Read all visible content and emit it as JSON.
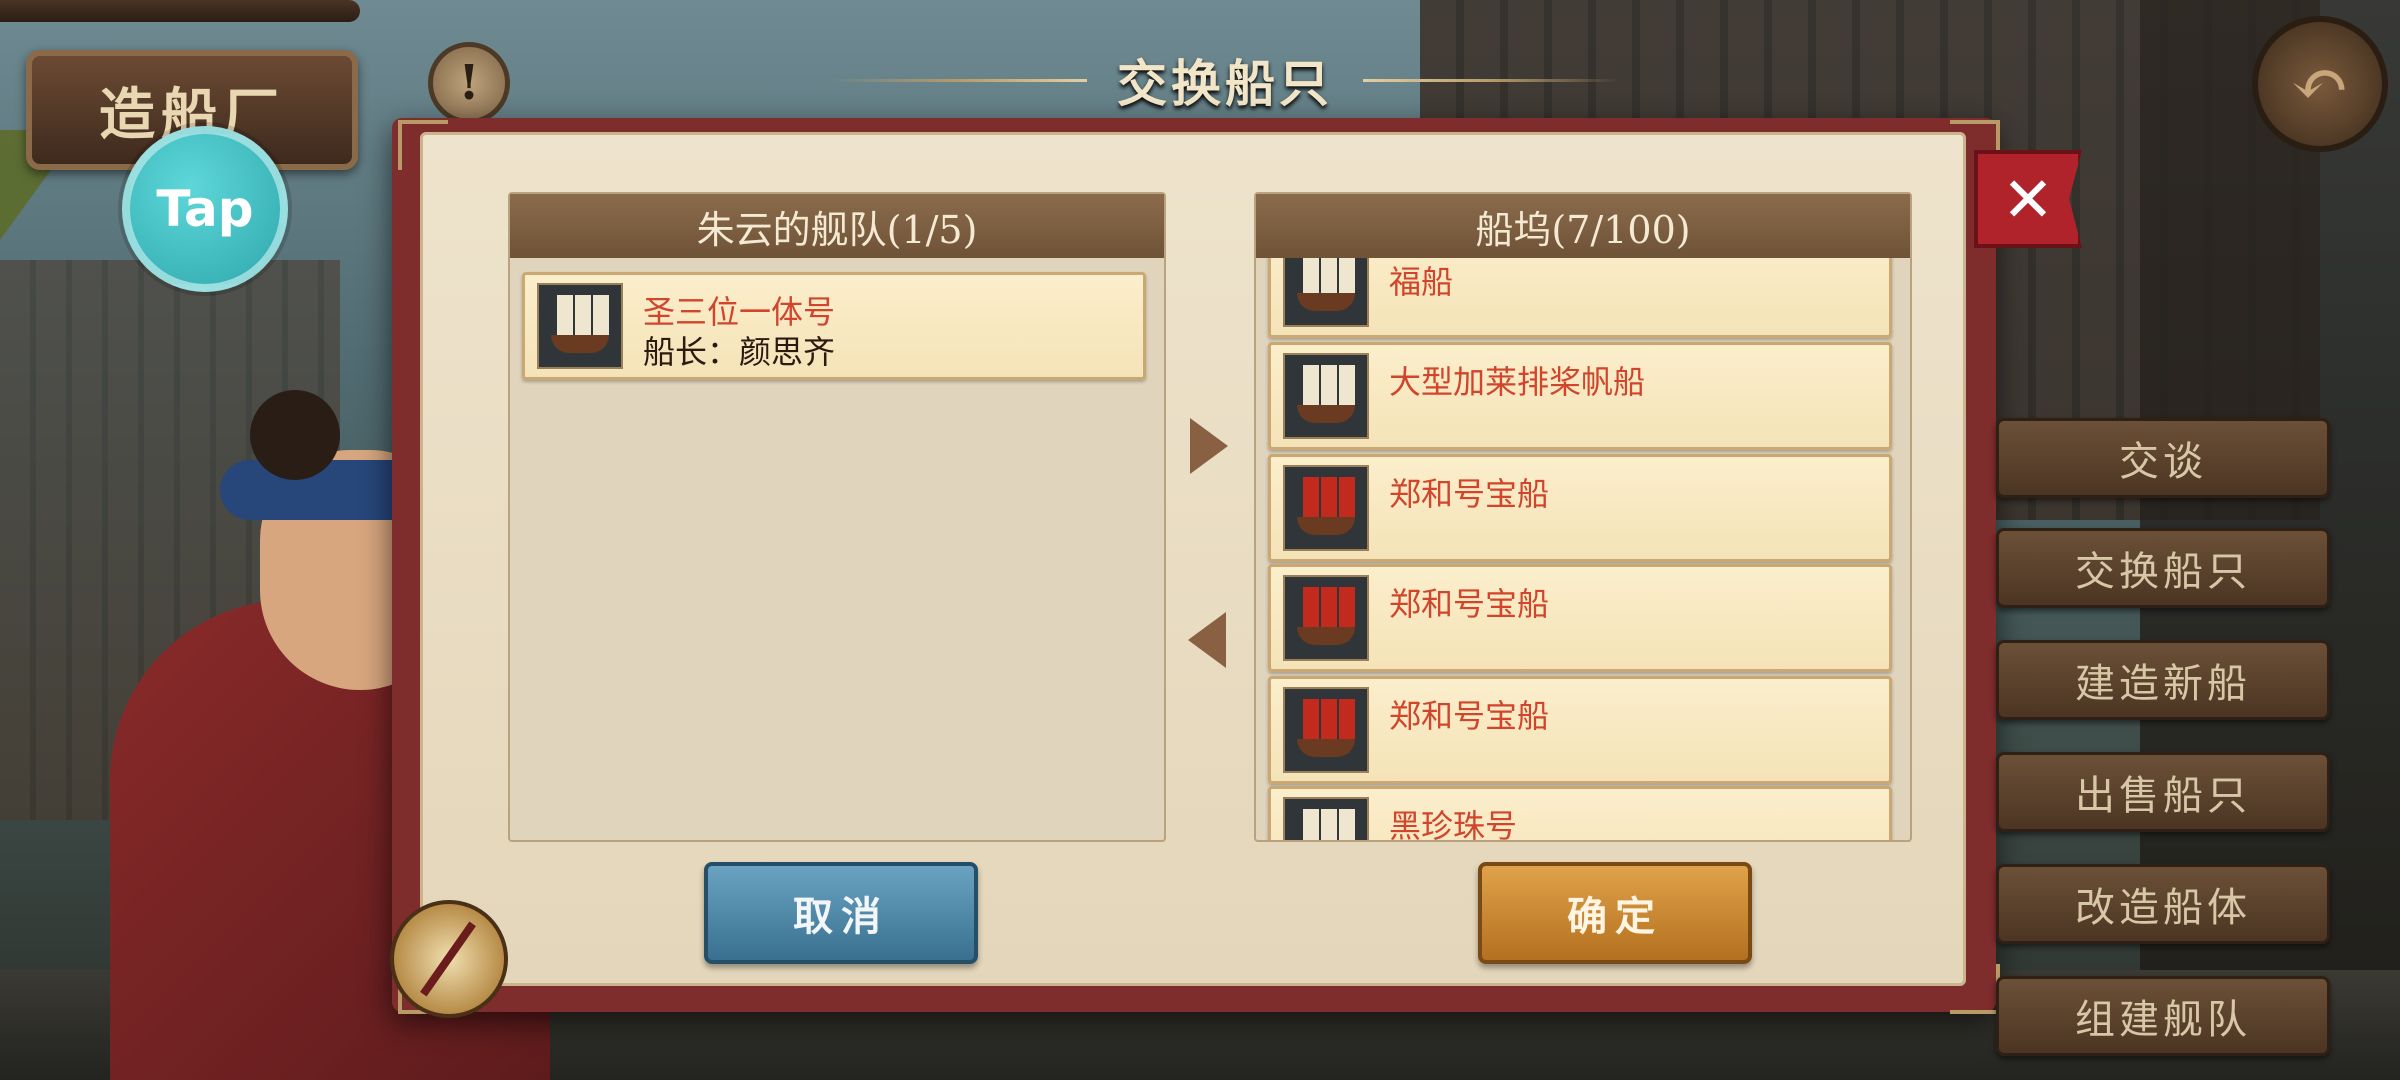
{
  "sign": {
    "label": "造船厂"
  },
  "tap_button": {
    "label": "Tap"
  },
  "info_button": {
    "label": "!"
  },
  "dialog": {
    "title": "交换船只"
  },
  "left_panel": {
    "title": "朱云的舰队(1/5)",
    "ships": [
      {
        "name": "圣三位一体号",
        "captain": "船长：颜思齐",
        "sail_color": "white"
      }
    ]
  },
  "right_panel": {
    "title": "船坞(7/100)",
    "ships": [
      {
        "name": "福船",
        "sail_color": "white"
      },
      {
        "name": "大型加莱排桨帆船",
        "sail_color": "white"
      },
      {
        "name": "郑和号宝船",
        "sail_color": "red"
      },
      {
        "name": "郑和号宝船",
        "sail_color": "red"
      },
      {
        "name": "郑和号宝船",
        "sail_color": "red"
      },
      {
        "name": "黑珍珠号",
        "sail_color": "white"
      }
    ]
  },
  "buttons": {
    "cancel": "取消",
    "confirm": "确定"
  },
  "menu": [
    "交谈",
    "交换船只",
    "建造新船",
    "出售船只",
    "改造船体",
    "组建舰队"
  ],
  "colors": {
    "ship_name": "#d0452c",
    "cancel": "#39708f",
    "confirm": "#b4701f",
    "book_frame": "#7e2c2c"
  }
}
